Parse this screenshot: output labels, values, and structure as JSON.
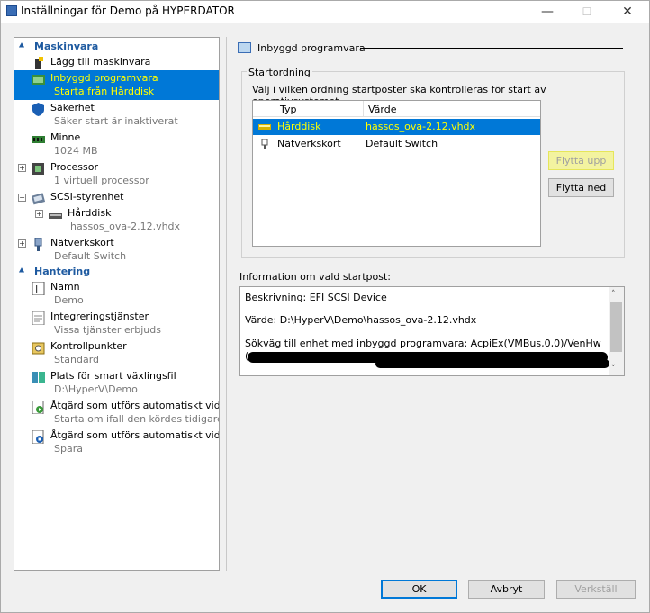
{
  "window": {
    "title": "Inställningar för Demo på HYPERDATOR",
    "minimize": "—",
    "maximize": "☐",
    "close": "✕"
  },
  "sidebar": {
    "sections": [
      {
        "label": "Maskinvara",
        "items": [
          {
            "label": "Lägg till maskinvara",
            "sub": "",
            "icon": "add-hardware-icon",
            "expand": ""
          },
          {
            "label": "Inbyggd programvara",
            "sub": "Starta från Hårddisk",
            "icon": "firmware-icon",
            "expand": "",
            "selected": true
          },
          {
            "label": "Säkerhet",
            "sub": "Säker start är inaktiverat",
            "icon": "shield-icon",
            "expand": ""
          },
          {
            "label": "Minne",
            "sub": "1024 MB",
            "icon": "memory-icon",
            "expand": ""
          },
          {
            "label": "Processor",
            "sub": "1 virtuell processor",
            "icon": "processor-icon",
            "expand": "+"
          },
          {
            "label": "SCSI-styrenhet",
            "sub": "",
            "icon": "scsi-icon",
            "expand": "−"
          },
          {
            "label": "Hårddisk",
            "sub": "hassos_ova-2.12.vhdx",
            "icon": "harddisk-icon",
            "expand": "+",
            "indent": true
          },
          {
            "label": "Nätverkskort",
            "sub": "Default Switch",
            "icon": "network-icon",
            "expand": "+"
          }
        ]
      },
      {
        "label": "Hantering",
        "items": [
          {
            "label": "Namn",
            "sub": "Demo",
            "icon": "name-icon"
          },
          {
            "label": "Integreringstjänster",
            "sub": "Vissa tjänster erbjuds",
            "icon": "integration-icon"
          },
          {
            "label": "Kontrollpunkter",
            "sub": "Standard",
            "icon": "checkpoint-icon"
          },
          {
            "label": "Plats för smart växlingsfil",
            "sub": "D:\\HyperV\\Demo",
            "icon": "paging-icon"
          },
          {
            "label": "Åtgärd som utförs automatiskt vid ...",
            "sub": "Starta om ifall den kördes tidigare",
            "icon": "auto-start-icon"
          },
          {
            "label": "Åtgärd som utförs automatiskt vid ...",
            "sub": "Spara",
            "icon": "auto-stop-icon"
          }
        ]
      }
    ]
  },
  "firmware": {
    "title": "Inbyggd programvara",
    "group_label": "Startordning",
    "description": "Välj i vilken ordning startposter ska kontrolleras för start av operativsystemet.",
    "columns": [
      "Typ",
      "Värde"
    ],
    "rows": [
      {
        "type": "Hårddisk",
        "value": "hassos_ova-2.12.vhdx",
        "icon": "harddisk-icon",
        "selected": true
      },
      {
        "type": "Nätverkskort",
        "value": "Default Switch",
        "icon": "network-icon",
        "selected": false
      }
    ],
    "move_up": "Flytta upp",
    "move_down": "Flytta ned",
    "info_label": "Information om vald startpost:",
    "info_lines": [
      "Beskrivning: EFI SCSI Device",
      "Värde: D:\\HyperV\\Demo\\hassos_ova-2.12.vhdx",
      "Sökväg till enhet med inbyggd programvara: AcpiEx(VMBus,0,0)/VenHw",
      "("
    ]
  },
  "footer": {
    "ok": "OK",
    "cancel": "Avbryt",
    "apply": "Verkställ"
  },
  "colors": {
    "selection": "#0078d7",
    "highlight": "#ffff00",
    "section_head": "#1e5aa0"
  }
}
